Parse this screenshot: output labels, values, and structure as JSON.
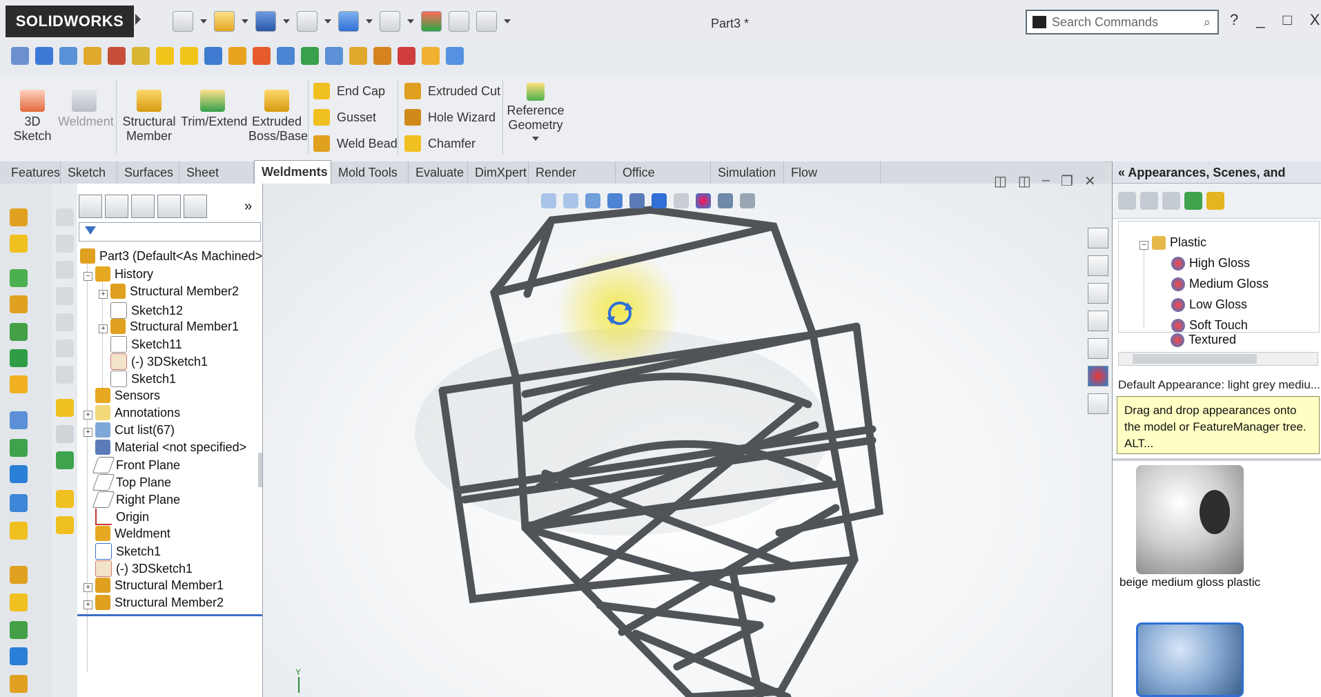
{
  "app": {
    "brand": "SOLIDWORKS",
    "document_title": "Part3 *"
  },
  "search": {
    "placeholder": "Search Commands"
  },
  "window_controls": [
    "?",
    "_",
    "□",
    "X"
  ],
  "ribbon": {
    "big_buttons": [
      {
        "label": "3D\nSketch",
        "icon": "3d-sketch-icon"
      },
      {
        "label": "Weldment",
        "icon": "weldment-icon"
      },
      {
        "label": "Structural\nMember",
        "icon": "structural-member-icon"
      },
      {
        "label": "Trim/Extend",
        "icon": "trim-extend-icon"
      },
      {
        "label": "Extruded\nBoss/Base",
        "icon": "extruded-boss-icon"
      }
    ],
    "small_col1": [
      "End Cap",
      "Gusset",
      "Weld Bead"
    ],
    "small_col2": [
      "Extruded Cut",
      "Hole Wizard",
      "Chamfer"
    ],
    "reference_geometry": "Reference\nGeometry"
  },
  "tabs": [
    "Features",
    "Sketch",
    "Surfaces",
    "Sheet Metal",
    "Weldments",
    "Mold Tools",
    "Evaluate",
    "DimXpert",
    "Render Tools",
    "Office Products",
    "Simulation",
    "Flow Simulation"
  ],
  "active_tab": "Weldments",
  "feature_tree": {
    "root": "Part3  (Default<As Machined>",
    "items": [
      {
        "label": "History",
        "level": 0
      },
      {
        "label": "Structural Member2",
        "level": 1
      },
      {
        "label": "Sketch12",
        "level": 1
      },
      {
        "label": "Structural Member1",
        "level": 1
      },
      {
        "label": "Sketch11",
        "level": 1
      },
      {
        "label": "(-) 3DSketch1",
        "level": 1
      },
      {
        "label": "Sketch1",
        "level": 1
      },
      {
        "label": "Sensors",
        "level": 0
      },
      {
        "label": "Annotations",
        "level": 0
      },
      {
        "label": "Cut list(67)",
        "level": 0
      },
      {
        "label": "Material <not specified>",
        "level": 0
      },
      {
        "label": "Front Plane",
        "level": 0
      },
      {
        "label": "Top Plane",
        "level": 0
      },
      {
        "label": "Right Plane",
        "level": 0
      },
      {
        "label": "Origin",
        "level": 0
      },
      {
        "label": "Weldment",
        "level": 0
      },
      {
        "label": "Sketch1",
        "level": 0
      },
      {
        "label": "(-) 3DSketch1",
        "level": 0
      },
      {
        "label": "Structural Member1",
        "level": 0
      },
      {
        "label": "Structural Member2",
        "level": 0
      }
    ]
  },
  "task_pane": {
    "title": "Appearances, Scenes, and Decals",
    "tree": [
      "Plastic",
      "High Gloss",
      "Medium Gloss",
      "Low Gloss",
      "Soft Touch",
      "Textured"
    ],
    "default_appearance": "Default Appearance: light grey mediu...",
    "tip": "Drag and drop appearances onto the model or FeatureManager tree.  ALT...",
    "swatches": [
      "beige medium gloss plastic"
    ]
  },
  "colors": {
    "accent_blue": "#2f6fd6",
    "frame_gray": "#505357",
    "highlight_yellow": "#f2e21a",
    "tip_yellow": "#ffffc4"
  }
}
